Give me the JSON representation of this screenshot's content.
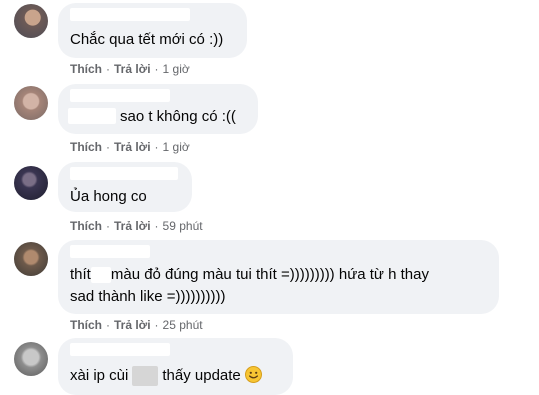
{
  "comments": [
    {
      "text": "Chắc qua tết mới có :))",
      "like": "Thích",
      "reply": "Trả lời",
      "time": "1 giờ"
    },
    {
      "text": "sao t không có :((",
      "like": "Thích",
      "reply": "Trả lời",
      "time": "1 giờ"
    },
    {
      "text": "Ủa hong co",
      "like": "Thích",
      "reply": "Trả lời",
      "time": "59 phút"
    },
    {
      "text_start": "thít",
      "text_rest": "màu đỏ đúng màu tui thít =))))))))) hứa từ h thay",
      "text_line2": "sad thành like =))))))))))",
      "like": "Thích",
      "reply": "Trả lời",
      "time": "25 phút"
    },
    {
      "text_start": "xài ip cùi",
      "text_rest": "thấy update",
      "emoji": "smiling-face"
    }
  ],
  "colors": {
    "bubble": "#f0f2f5",
    "text": "#050505",
    "meta": "#65676b"
  }
}
